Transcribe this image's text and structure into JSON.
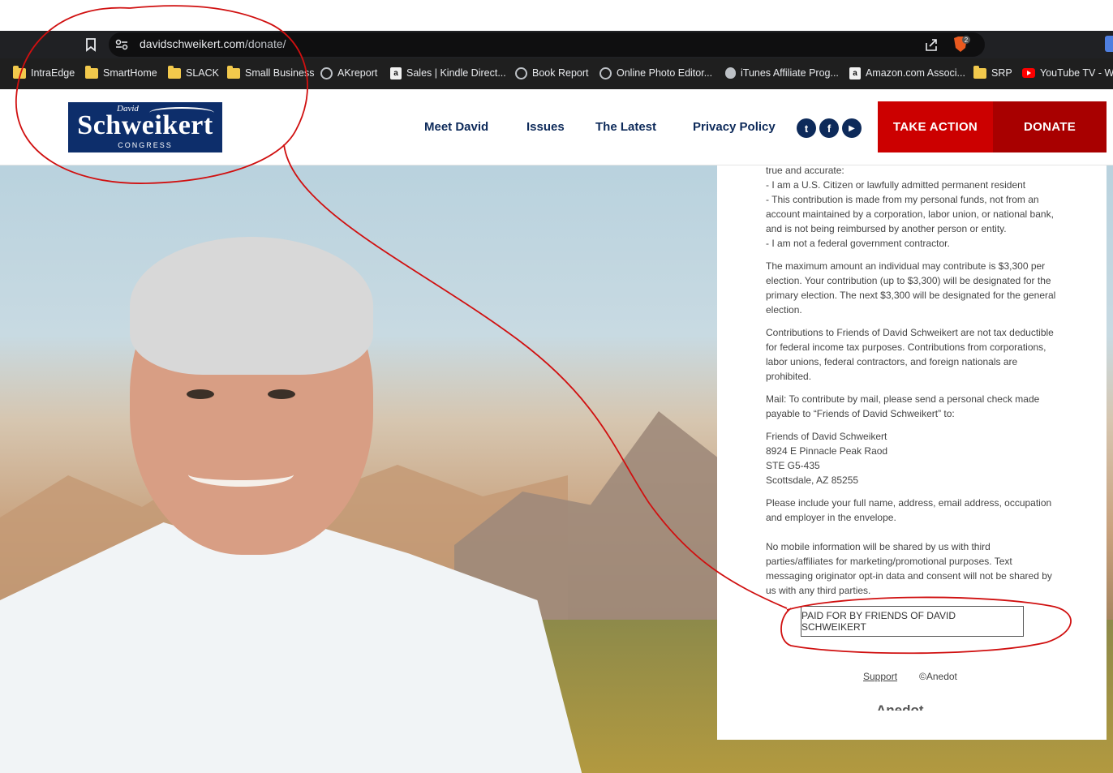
{
  "browser": {
    "url_host": "davidschweikert.com",
    "url_path": "/donate/",
    "brave_badge": "2",
    "bookmarks": [
      {
        "label": "IntraEdge",
        "icon": "folder-icon"
      },
      {
        "label": "SmartHome",
        "icon": "folder-icon"
      },
      {
        "label": "SLACK",
        "icon": "folder-icon"
      },
      {
        "label": "Small Business",
        "icon": "folder-icon"
      },
      {
        "label": "AKreport",
        "icon": "globe-icon"
      },
      {
        "label": "Sales | Kindle Direct...",
        "icon": "amazon-icon"
      },
      {
        "label": "Book Report",
        "icon": "globe-icon"
      },
      {
        "label": "Online Photo Editor...",
        "icon": "globe-icon"
      },
      {
        "label": "iTunes Affiliate Prog...",
        "icon": "apple-icon"
      },
      {
        "label": "Amazon.com Associ...",
        "icon": "amazon-icon"
      },
      {
        "label": "SRP",
        "icon": "folder-icon"
      },
      {
        "label": "YouTube TV - Wa",
        "icon": "youtube-icon"
      }
    ]
  },
  "site": {
    "logo": {
      "first": "David",
      "last": "Schweikert",
      "sub": "CONGRESS"
    },
    "nav": [
      "Meet David",
      "Issues",
      "The Latest",
      "Privacy Policy"
    ],
    "social": [
      {
        "name": "twitter-icon",
        "glyph": "t"
      },
      {
        "name": "facebook-icon",
        "glyph": "f"
      },
      {
        "name": "youtube-icon",
        "glyph": "▶"
      }
    ],
    "take_action": "TAKE ACTION",
    "donate": "DONATE"
  },
  "panel": {
    "p1": [
      "true and accurate:",
      "- I am a U.S. Citizen or lawfully admitted permanent resident",
      "- This contribution is made from my personal funds, not from an account maintained by a corporation, labor union, or national bank, and is not being reimbursed by another person or entity.",
      "- I am not a federal government contractor."
    ],
    "p2": "The maximum amount an individual may contribute is $3,300 per election. Your contribution (up to $3,300) will be designated for the primary election. The next $3,300 will be designated for the general election.",
    "p3": "Contributions to Friends of David Schweikert are not tax deductible for federal income tax purposes. Contributions from corporations, labor unions, federal contractors, and foreign nationals are prohibited.",
    "p4": "Mail: To contribute by mail, please send a personal check made payable to “Friends of David Schweikert” to:",
    "address": [
      "Friends of David Schweikert",
      "8924 E Pinnacle Peak Raod",
      "STE G5-435",
      "Scottsdale, AZ 85255"
    ],
    "p5": "Please include your full name, address, email address, occupation and employer in the envelope.",
    "p6": "No mobile information will be shared by us with third parties/affiliates for marketing/promotional purposes. Text messaging originator opt-in data and consent will not be shared by us with any third parties.",
    "paid_for": "PAID FOR BY FRIENDS OF DAVID SCHWEIKERT",
    "support": "Support",
    "copyright": "©Anedot",
    "anedot": "Anedot"
  },
  "colors": {
    "navy": "#0d2a5a",
    "red": "#cc0000",
    "dark_red": "#a80000",
    "annotation": "#d01010"
  }
}
